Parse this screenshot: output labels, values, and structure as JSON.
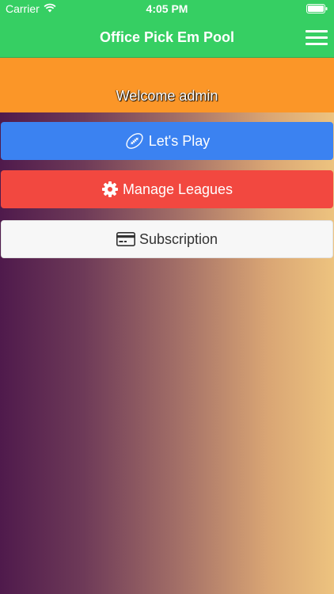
{
  "status_bar": {
    "carrier": "Carrier",
    "time": "4:05 PM"
  },
  "nav": {
    "title": "Office Pick Em Pool"
  },
  "welcome": {
    "text": "Welcome admin"
  },
  "buttons": {
    "play_label": "Let's Play",
    "leagues_label": "Manage Leagues",
    "subscription_label": "Subscription"
  },
  "icons": {
    "play": "football-icon",
    "leagues": "gear-icon",
    "subscription": "credit-card-icon",
    "menu": "hamburger-menu-icon"
  },
  "colors": {
    "nav_green": "#36cf63",
    "welcome_orange": "#fb9628",
    "play_blue": "#3b82f1",
    "leagues_red": "#f24840",
    "subscription_gray": "#f7f7f7"
  }
}
